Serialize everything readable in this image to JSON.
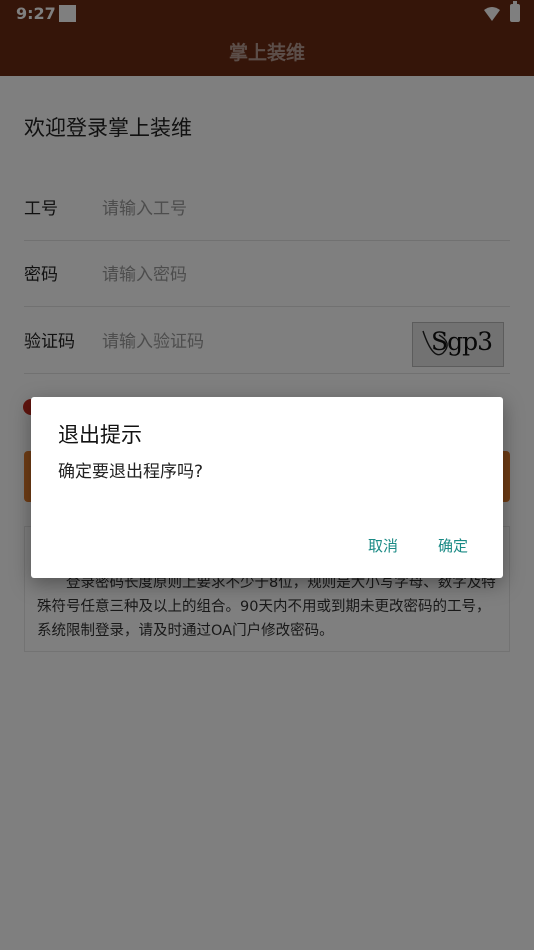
{
  "status_bar": {
    "time": "9:27"
  },
  "app_bar": {
    "title": "掌上装维"
  },
  "page": {
    "welcome": "欢迎登录掌上装维",
    "fields": [
      {
        "label": "工号",
        "placeholder": "请输入工号"
      },
      {
        "label": "密码",
        "placeholder": "请输入密码"
      },
      {
        "label": "验证码",
        "placeholder": "请输入验证码"
      }
    ],
    "captcha_text": "Sgp3",
    "notice": "登录密码长度原则上要求不少于8位，规则是大小写字母、数字及特殊符号任意三种及以上的组合。90天内不用或到期未更改密码的工号，系统限制登录，请及时通过OA门户修改密码。"
  },
  "dialog": {
    "title": "退出提示",
    "message": "确定要退出程序吗?",
    "cancel_label": "取消",
    "ok_label": "确定"
  },
  "colors": {
    "app_bar": "#6b2a12",
    "login_button": "#e07a2b",
    "dialog_button_text": "#1a8a85",
    "remember_dot": "#c0281c"
  }
}
